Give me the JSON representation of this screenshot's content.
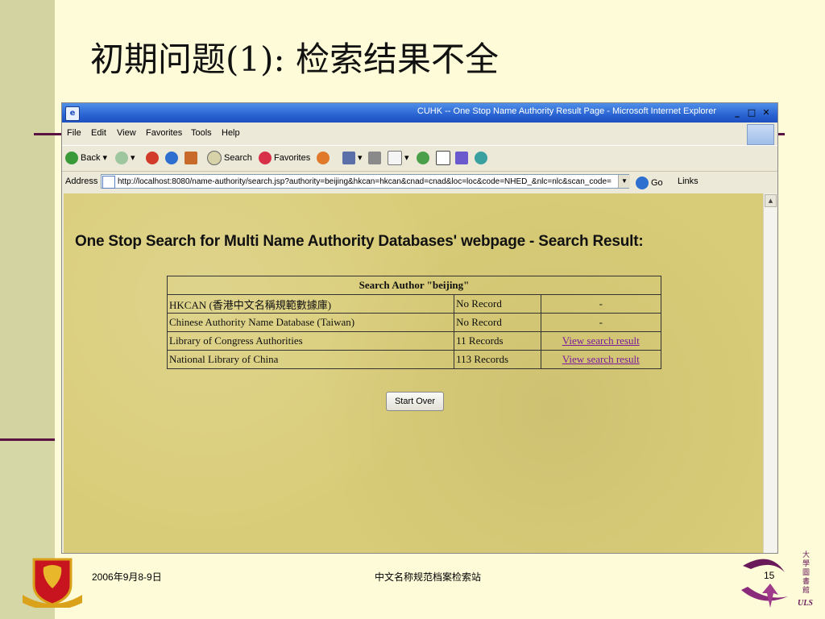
{
  "slide": {
    "title": "初期问题(1): 检索结果不全",
    "footer_date": "2006年9月8-9日",
    "footer_center": "中文名称规范档案检索站",
    "page_number": "15",
    "uls_text": "ULS",
    "uls_chars": "大學圖書館"
  },
  "browser": {
    "window_title": "CUHK -- One Stop Name Authority Result Page - Microsoft Internet Explorer",
    "menu": [
      "File",
      "Edit",
      "View",
      "Favorites",
      "Tools",
      "Help"
    ],
    "toolbar": {
      "back": "Back",
      "search": "Search",
      "favorites": "Favorites"
    },
    "address_label": "Address",
    "address_url": "http://localhost:8080/name-authority/search.jsp?authority=beijing&hkcan=hkcan&cnad=cnad&loc=loc&code=NHED_&nlc=nlc&scan_code=",
    "go_label": "Go",
    "links_label": "Links"
  },
  "page": {
    "heading": "One Stop Search for Multi Name Authority Databases' webpage - Search Result:",
    "table_header": "Search Author \"beijing\"",
    "rows": [
      {
        "db": "HKCAN (香港中文名稱規範數據庫)",
        "records": "No Record",
        "action": "-"
      },
      {
        "db": "Chinese Authority Name Database (Taiwan)",
        "records": "No Record",
        "action": "-"
      },
      {
        "db": "Library of Congress Authorities",
        "records": "11 Records",
        "action": "View search result"
      },
      {
        "db": "National Library of China",
        "records": "113 Records",
        "action": "View search result"
      }
    ],
    "start_over": "Start Over"
  },
  "colors": {
    "accent": "#5a1242",
    "page_bg": "#d9cc78",
    "link": "#7a1a9a",
    "title_bar": "#2a64d3"
  }
}
